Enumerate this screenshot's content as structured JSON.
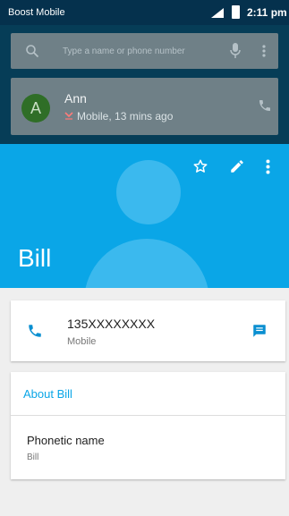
{
  "status_bar": {
    "carrier": "Boost Mobile",
    "time": "2:11 pm"
  },
  "search": {
    "placeholder": "Type a name or phone number"
  },
  "recent_call": {
    "avatar_letter": "A",
    "name": "Ann",
    "detail": "Mobile, 13 mins ago"
  },
  "contact": {
    "name": "Bill",
    "phone_number": "135XXXXXXXX",
    "phone_type": "Mobile",
    "about_label": "About Bill",
    "phonetic_label": "Phonetic name",
    "phonetic_value": "Bill"
  },
  "colors": {
    "accent": "#0aa6e7",
    "status_bar": "#05314d",
    "card": "#ffffff"
  },
  "icons": [
    "search-icon",
    "mic-icon",
    "more-vert-icon",
    "phone-icon",
    "star-icon",
    "edit-icon",
    "message-icon",
    "missed-call-icon"
  ]
}
